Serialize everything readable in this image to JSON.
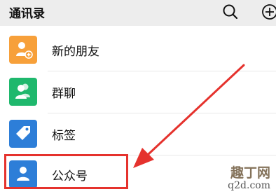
{
  "header": {
    "title": "通讯录",
    "search_icon": "search-icon",
    "add_icon": "add-circle-icon"
  },
  "contacts": {
    "items": [
      {
        "label": "新的朋友",
        "icon": "add-friend-icon",
        "color": "#f7a03a"
      },
      {
        "label": "群聊",
        "icon": "group-chat-icon",
        "color": "#1fb86d"
      },
      {
        "label": "标签",
        "icon": "tag-icon",
        "color": "#2d7ed8"
      },
      {
        "label": "公众号",
        "icon": "official-account-icon",
        "color": "#2d7ed8"
      }
    ]
  },
  "annotation": {
    "highlight_color": "#e5322d"
  },
  "watermark": {
    "main": "趣丁网",
    "sub": "q2d.com"
  }
}
